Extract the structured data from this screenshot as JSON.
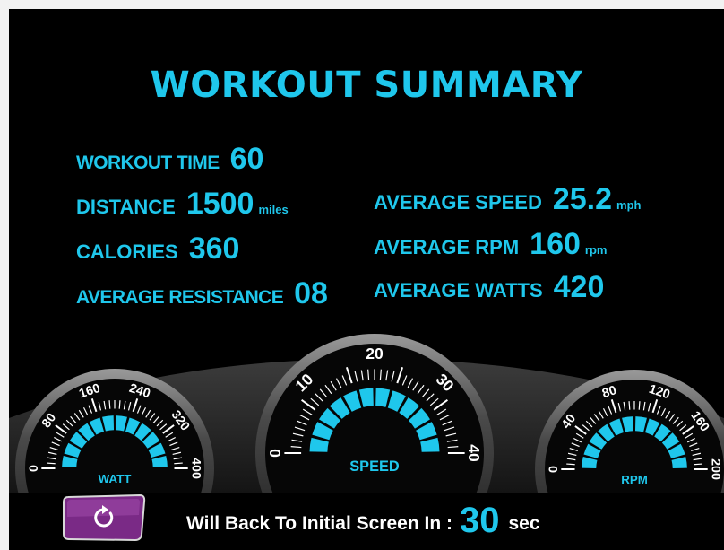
{
  "title": "WORKOUT SUMMARY",
  "stats_left": [
    {
      "label": "WORKOUT TIME",
      "value": "60",
      "unit": ""
    },
    {
      "label": "DISTANCE",
      "value": "1500",
      "unit": "miles"
    },
    {
      "label": "CALORIES",
      "value": "360",
      "unit": ""
    },
    {
      "label": "AVERAGE RESISTANCE",
      "value": "08",
      "unit": ""
    }
  ],
  "stats_right": [
    {
      "label": "AVERAGE SPEED",
      "value": "25.2",
      "unit": "mph"
    },
    {
      "label": "AVERAGE RPM",
      "value": "160",
      "unit": "rpm"
    },
    {
      "label": "AVERAGE WATTS",
      "value": "420",
      "unit": ""
    }
  ],
  "gauges": {
    "watt": {
      "label": "WATT",
      "ticks": [
        "0",
        "80",
        "160",
        "240",
        "320",
        "400"
      ]
    },
    "speed": {
      "label": "SPEED",
      "ticks": [
        "0",
        "10",
        "20",
        "30",
        "40"
      ]
    },
    "rpm": {
      "label": "RPM",
      "ticks": [
        "0",
        "40",
        "80",
        "120",
        "160",
        "200"
      ]
    }
  },
  "footer": {
    "message": "Will Back To Initial Screen In :",
    "countdown": "30",
    "unit": "sec"
  },
  "icons": {
    "refresh": "refresh-icon"
  },
  "colors": {
    "accent": "#1fc7ec",
    "background": "#000000",
    "button": "#7a2a86"
  }
}
